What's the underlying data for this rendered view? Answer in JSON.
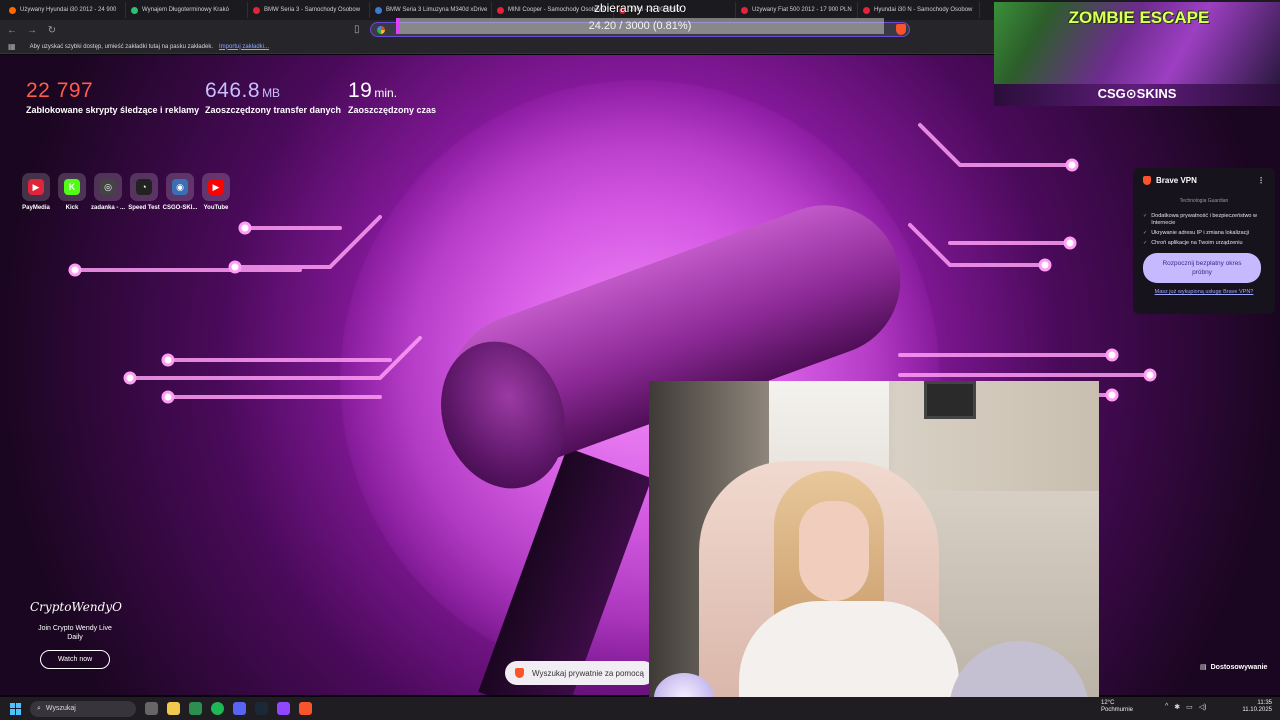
{
  "browser": {
    "tabs": [
      {
        "label": "Używany Hyundai i30 2012 - 24 900",
        "color": "#ff6a00"
      },
      {
        "label": "Wynajem Długoterminowy Krakó",
        "color": "#2fbf71"
      },
      {
        "label": "BMW Seria 3 - Samochody Osobow",
        "color": "#e0243a"
      },
      {
        "label": "BMW Seria 3 Limuzyna M340d xDrive",
        "color": "#3a7bd5"
      },
      {
        "label": "MINI Cooper - Samochody Osobowe",
        "color": "#e0243a"
      },
      {
        "label": "2008 - 20 000 PLN",
        "color": "#e0243a"
      },
      {
        "label": "Używany Fiat 500 2012 - 17 900 PLN",
        "color": "#e0243a"
      },
      {
        "label": "Hyundai i30 N - Samochody Osobow",
        "color": "#e0243a"
      }
    ],
    "bookmarks_text": "Aby uzyskać szybki dostęp, umieść zakładki tutaj na pasku zakładek.",
    "bookmarks_link": "Importuj zakładki..."
  },
  "overlay": {
    "goal_title": "zbieramy na auto",
    "goal_text": "24.20 / 3000 (0.81%)",
    "goal_fraction": 0.0081
  },
  "ntp": {
    "stats": [
      {
        "value": "22 797",
        "unit": "",
        "label": "Zablokowane skrypty śledzące i reklamy",
        "color": "#ff5c4d"
      },
      {
        "value": "646.8",
        "unit": "MB",
        "label": "Zaoszczędzony transfer danych",
        "color": "#c9bfff"
      },
      {
        "value": "19",
        "unit": "min.",
        "label": "Zaoszczędzony czas",
        "color": "#ffffff"
      }
    ],
    "tiles": [
      {
        "label": "PayMedia",
        "glyph": "▶",
        "color": "#e0243a"
      },
      {
        "label": "Kick",
        "glyph": "K",
        "color": "#53fc18"
      },
      {
        "label": "zadanka - ...",
        "glyph": "◎",
        "color": "#444444"
      },
      {
        "label": "Speed Test",
        "glyph": "◔",
        "color": "#222222"
      },
      {
        "label": "CSGO-SKI...",
        "glyph": "◉",
        "color": "#3a6fb5"
      },
      {
        "label": "YouTube",
        "glyph": "▶",
        "color": "#ff0000"
      }
    ],
    "sponsor_logo": "CryptoWendyO",
    "sponsor_sub": "Join Crypto Wendy Live Daily",
    "sponsor_button": "Watch now",
    "search_placeholder": "Wyszukaj prywatnie za pomocą",
    "customize": "Dostosowywanie"
  },
  "vpn": {
    "title": "Brave VPN",
    "tech": "Technologia Guardian",
    "features": [
      "Dodatkowa prywatność i bezpieczeństwo w Internecie",
      "Ukrywanie adresu IP i zmiana lokalizacji",
      "Chroń aplikacje na Twoim urządzeniu"
    ],
    "cta": "Rozpocznij bezpłatny okres próbny",
    "already": "Masz już wykupioną usługę Brave VPN?"
  },
  "ad": {
    "title": "ZOMBIE ESCAPE",
    "brand": "CSG⊙SKINS"
  },
  "taskbar": {
    "search": "Wyszukaj",
    "weather_temp": "12°C",
    "weather_desc": "Pochmurnie",
    "time": "11:35",
    "date": "11.10.2025"
  }
}
